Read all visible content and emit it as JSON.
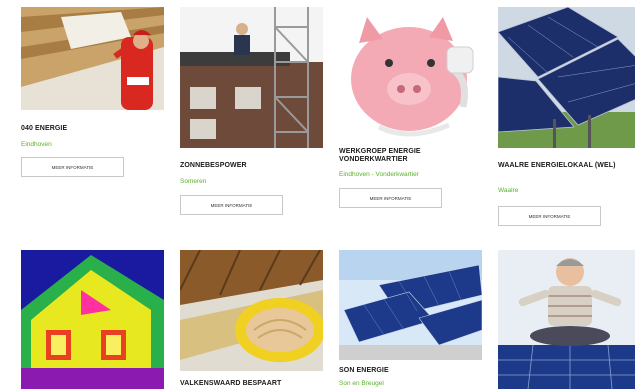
{
  "projects": [
    {
      "title": "040 Energie",
      "location": "Eindhoven",
      "button": "Meer informatie",
      "image": "insulation-installer-photo"
    },
    {
      "title": "Zonnebespower",
      "location": "Someren",
      "button": "Meer informatie",
      "image": "solar-roof-scaffold-photo"
    },
    {
      "title": "Werkgroep Energie Vonderkwartier",
      "location": "Eindhoven - Vonderkwartier",
      "button": "Meer informatie",
      "image": "piggy-bank-plug-photo"
    },
    {
      "title": "Waalre Energielokaal (WEL)",
      "location": "Waalre",
      "button": "Meer informatie",
      "image": "solar-field-photo"
    },
    {
      "title": "",
      "location": "",
      "button": "",
      "image": "thermal-house-photo"
    },
    {
      "title": "Valkenswaard bespaart",
      "location": "",
      "button": "",
      "image": "roof-insulation-photo"
    },
    {
      "title": "Son Energie",
      "location": "Son en Breugel",
      "button": "",
      "image": "solar-panels-sky-photo"
    },
    {
      "title": "",
      "location": "",
      "button": "",
      "image": "man-solar-panels-photo"
    }
  ],
  "colors": {
    "accent": "#5bb12a",
    "button_border": "#c8c8c8"
  }
}
